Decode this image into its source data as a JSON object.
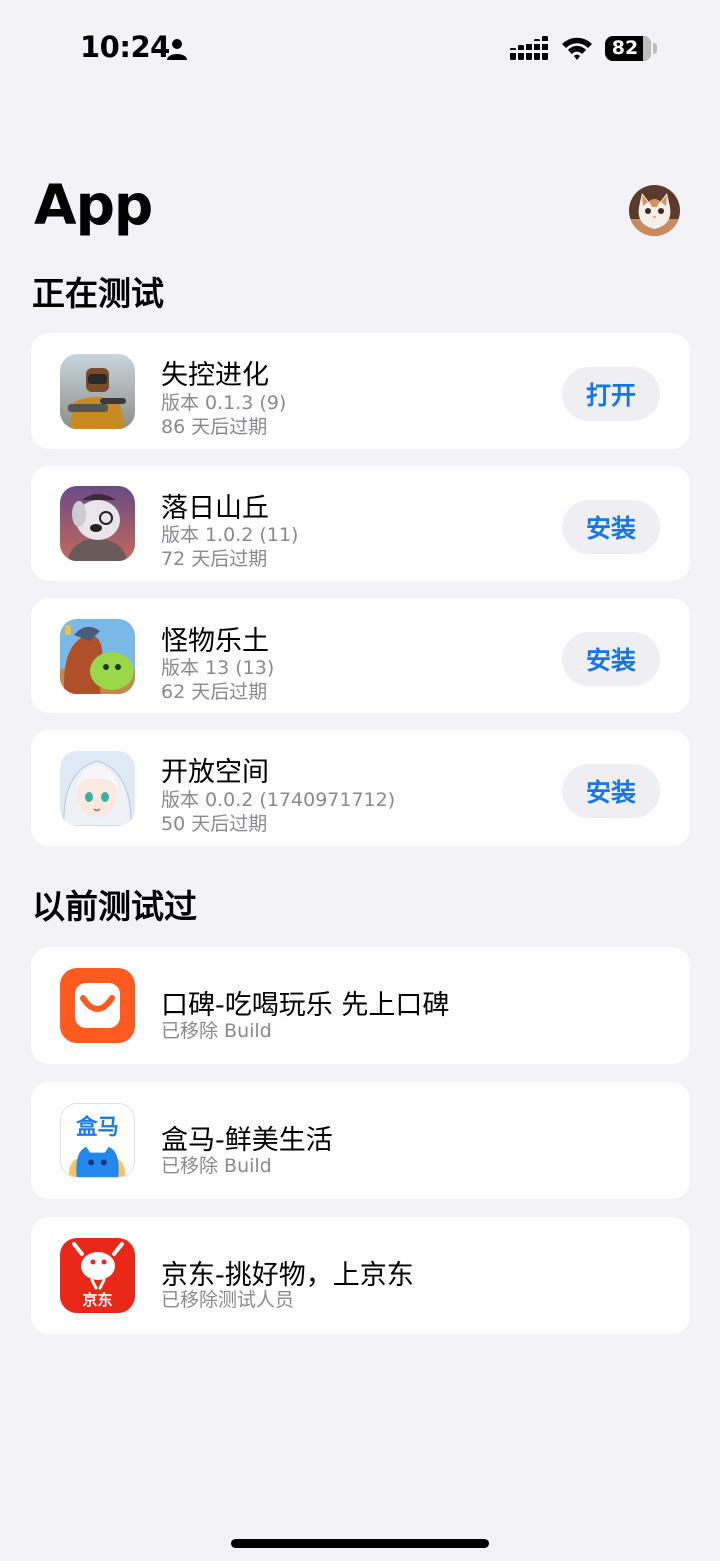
{
  "status_bar": {
    "time": "10:24",
    "battery": "82",
    "battery_level": 0.82
  },
  "header": {
    "title": "App"
  },
  "sections": {
    "testing": {
      "title": "正在测试",
      "apps": [
        {
          "name": "失控进化",
          "version": "版本 0.1.3 (9)",
          "expiry": "86 天后过期",
          "action": "打开",
          "icon": "survival-game-icon"
        },
        {
          "name": "落日山丘",
          "version": "版本 1.0.2 (11)",
          "expiry": "72 天后过期",
          "action": "安装",
          "icon": "dog-character-icon"
        },
        {
          "name": "怪物乐土",
          "version": "版本 13 (13)",
          "expiry": "62 天后过期",
          "action": "安装",
          "icon": "monster-game-icon"
        },
        {
          "name": "开放空间",
          "version": "版本 0.0.2 (1740971712)",
          "expiry": "50 天后过期",
          "action": "安装",
          "icon": "anime-girl-icon"
        }
      ]
    },
    "previous": {
      "title": "以前测试过",
      "apps": [
        {
          "name": "口碑-吃喝玩乐 先上口碑",
          "status": "已移除 Build",
          "icon": "koubei-icon"
        },
        {
          "name": "盒马-鲜美生活",
          "status": "已移除 Build",
          "icon": "hema-icon",
          "icon_text": "盒马"
        },
        {
          "name": "京东-挑好物，上京东",
          "status": "已移除测试人员",
          "icon": "jd-icon",
          "icon_text": "京东"
        }
      ]
    }
  },
  "colors": {
    "accent": "#1577e6",
    "background": "#f2f2f7",
    "koubei": "#ff5a1f",
    "jd": "#e9281a"
  }
}
